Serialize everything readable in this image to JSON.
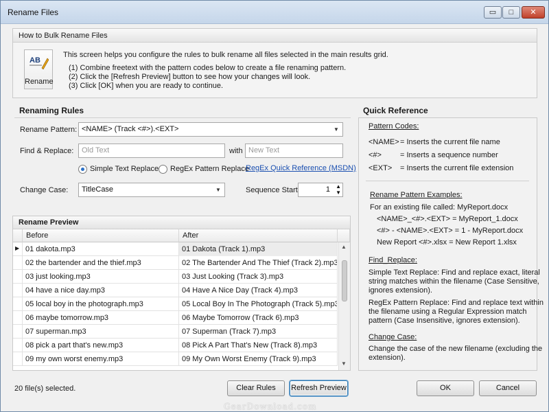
{
  "window": {
    "title": "Rename Files",
    "controls": {
      "minimize": "▭",
      "maximize": "□",
      "close": "✕"
    }
  },
  "howto": {
    "header": "How to Bulk Rename Files",
    "icon_label": "Rename",
    "icon_glyph": "AB",
    "intro": "This screen helps you configure the rules to bulk rename all files selected in the main results grid.",
    "steps": [
      "(1)  Combine freetext with the pattern codes below to create a file renaming pattern.",
      "(2)  Click the [Refresh Preview] button to see how your changes will look.",
      "(3)  Click [OK] when you are ready to continue."
    ]
  },
  "rules": {
    "header": "Renaming Rules",
    "pattern_label": "Rename Pattern:",
    "pattern_value": "<NAME> (Track <#>).<EXT>",
    "find_label": "Find & Replace:",
    "old_placeholder": "Old Text",
    "with_label": "with",
    "new_placeholder": "New Text",
    "simple_label": "Simple Text Replace",
    "regex_label": "RegEx Pattern Replace",
    "regex_link": "RegEx Quick Reference (MSDN)",
    "case_label": "Change Case:",
    "case_value": "TitleCase",
    "seq_label": "Sequence Start:",
    "seq_value": "1"
  },
  "preview": {
    "header": "Rename Preview",
    "columns": [
      "Before",
      "After"
    ],
    "rows": [
      {
        "before": "01 dakota.mp3",
        "after": "01 Dakota (Track 1).mp3"
      },
      {
        "before": "02 the bartender and the thief.mp3",
        "after": "02 The Bartender And The Thief (Track 2).mp3"
      },
      {
        "before": "03 just looking.mp3",
        "after": "03 Just Looking (Track 3).mp3"
      },
      {
        "before": "04 have a nice day.mp3",
        "after": "04 Have A Nice Day (Track 4).mp3"
      },
      {
        "before": "05 local boy in the photograph.mp3",
        "after": "05 Local Boy In The Photograph (Track 5).mp3"
      },
      {
        "before": "06 maybe tomorrow.mp3",
        "after": "06 Maybe Tomorrow (Track 6).mp3"
      },
      {
        "before": "07 superman.mp3",
        "after": "07 Superman (Track 7).mp3"
      },
      {
        "before": "08 pick a part that's new.mp3",
        "after": "08 Pick A Part That's New (Track 8).mp3"
      },
      {
        "before": "09 my own worst enemy.mp3",
        "after": "09 My Own Worst Enemy (Track 9).mp3"
      }
    ]
  },
  "quickref": {
    "header": "Quick Reference",
    "codes_title": "Pattern Codes:",
    "codes": [
      {
        "code": "<NAME>",
        "desc": "=  Inserts the current file name"
      },
      {
        "code": "<#>",
        "desc": "=  Inserts a sequence number"
      },
      {
        "code": "<EXT>",
        "desc": "=  Inserts the current file extension"
      }
    ],
    "examples_title": "Rename Pattern Examples:",
    "examples_intro": "For an existing file called: MyReport.docx",
    "examples": [
      "<NAME>_<#>.<EXT> = MyReport_1.docx",
      "<#> - <NAME>.<EXT> = 1 - MyReport.docx",
      "New Report <#>.xlsx = New Report 1.xlsx"
    ],
    "find_title": "Find_Replace:",
    "find_simple": [
      "Simple Text Replace: Find and replace exact, literal",
      "string matches within the filename (Case Sensitive,",
      "ignores extension)."
    ],
    "find_regex": [
      "RegEx Pattern Replace: Find and replace text within",
      "the filename using a Regular Expression match",
      "pattern (Case Insensitive, ignores extension)."
    ],
    "case_title": "Change Case:",
    "case_desc": [
      "Change the case of the new filename (excluding the",
      "extension)."
    ]
  },
  "footer": {
    "status": "20 file(s) selected.",
    "clear": "Clear Rules",
    "refresh": "Refresh Preview",
    "ok": "OK",
    "cancel": "Cancel"
  },
  "watermark": "GearDownload.com"
}
